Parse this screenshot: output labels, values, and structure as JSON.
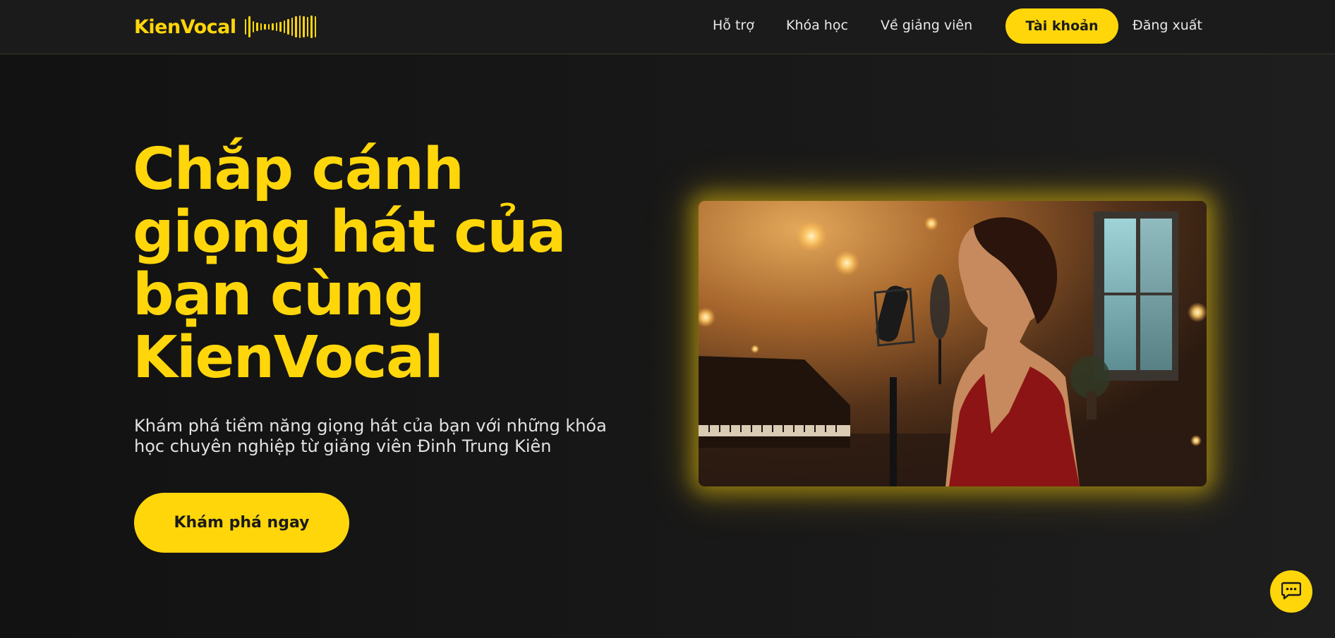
{
  "header": {
    "logo_text": "KienVocal",
    "logo_icon": "soundwave-icon",
    "nav": [
      {
        "label": "Hỗ trợ"
      },
      {
        "label": "Khóa học"
      },
      {
        "label": "Về giảng viên"
      }
    ],
    "account_label": "Tài khoản",
    "logout_label": "Đăng xuất"
  },
  "hero": {
    "title_lines": [
      "Chắp cánh",
      "giọng hát của",
      "bạn cùng",
      "KienVocal"
    ],
    "subtitle_lines": [
      "Khám phá tiềm năng giọng hát của bạn với những khóa",
      "học chuyên nghiệp từ giảng viên Đinh Trung Kiên"
    ],
    "cta_label": "Khám phá ngay",
    "image_icon": "singer-studio-photo"
  },
  "chat": {
    "icon": "chat-icon"
  },
  "colors": {
    "accent": "#ffd60a",
    "background": "#141414",
    "header_bg": "#1b1b1b",
    "text_light": "#e2e2e2",
    "text_dark": "#1a1a1a"
  }
}
